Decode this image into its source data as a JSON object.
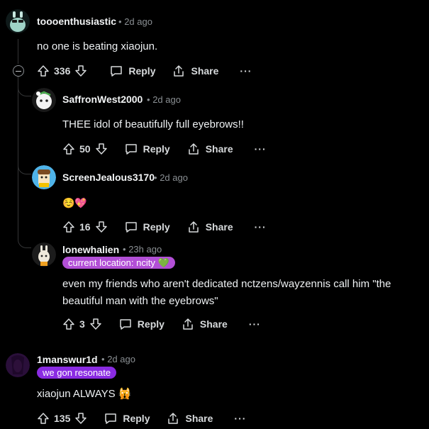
{
  "comments": [
    {
      "username": "toooenthusiastic",
      "time": "2d ago",
      "body": "no one is beating xiaojun.",
      "votes": "336",
      "avatar_color": "#9fd3c7"
    },
    {
      "username": "SaffronWest2000",
      "time": "2d ago",
      "body": "THEE idol of beautifully full eyebrows!!",
      "votes": "50",
      "avatar_color": "#e8e8e8"
    },
    {
      "username": "ScreenJealous3170",
      "time": "2d ago",
      "body": "☺️💖",
      "votes": "16",
      "avatar_color": "#4fb3e8"
    },
    {
      "username": "lonewhalien",
      "time": "23h ago",
      "flair": "current location: ncity 💚",
      "flair_color": "#b24fd6",
      "body_line1": "even my friends who aren't dedicated nctzens/wayzennis call him \"the",
      "body_line2": "beautiful man with the eyebrows\"",
      "votes": "3",
      "avatar_color": "#f0c040"
    },
    {
      "username": "1manswur1d",
      "time": "2d ago",
      "flair": "we gon resonate",
      "flair_color": "#8a2be2",
      "body": "xiaojun ALWAYS 🙀",
      "votes": "135",
      "avatar_color": "#2a0f3a"
    }
  ],
  "actions": {
    "reply": "Reply",
    "share": "Share",
    "more": "···",
    "separator": "•"
  }
}
